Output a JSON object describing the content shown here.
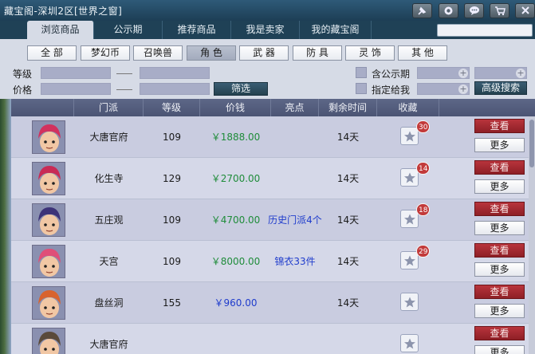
{
  "window": {
    "title": "藏宝阁-深圳2区[世界之窗]"
  },
  "tabs": [
    {
      "label": "浏览商品",
      "active": true
    },
    {
      "label": "公示期",
      "active": false
    },
    {
      "label": "推荐商品",
      "active": false
    },
    {
      "label": "我是卖家",
      "active": false
    },
    {
      "label": "我的藏宝阁",
      "active": false
    }
  ],
  "search": {
    "value": "",
    "placeholder": ""
  },
  "categories": [
    {
      "label": "全 部",
      "active": false
    },
    {
      "label": "梦幻币",
      "active": false
    },
    {
      "label": "召唤兽",
      "active": false
    },
    {
      "label": "角 色",
      "active": true
    },
    {
      "label": "武 器",
      "active": false
    },
    {
      "label": "防 具",
      "active": false
    },
    {
      "label": "灵 饰",
      "active": false
    },
    {
      "label": "其 他",
      "active": false
    }
  ],
  "filter": {
    "level_label": "等级",
    "price_label": "价格",
    "filter_button": "筛选",
    "include_public_label": "含公示期",
    "designated_label": "指定给我",
    "advanced_search_button": "高级搜索"
  },
  "table": {
    "headers": [
      "门派",
      "等级",
      "价钱",
      "亮点",
      "剩余时间",
      "收藏"
    ],
    "view_label": "查看",
    "more_label": "更多",
    "rows": [
      {
        "school": "大唐官府",
        "level": "109",
        "price": "￥1888.00",
        "price_color": "green",
        "highlight": "",
        "time": "14天",
        "favorites": "30",
        "avatar_color": "#b8365a",
        "hair_color": "#d2315e"
      },
      {
        "school": "化生寺",
        "level": "129",
        "price": "￥2700.00",
        "price_color": "green",
        "highlight": "",
        "time": "14天",
        "favorites": "14",
        "avatar_color": "#b8365a",
        "hair_color": "#c92b55"
      },
      {
        "school": "五庄观",
        "level": "109",
        "price": "￥4700.00",
        "price_color": "green",
        "highlight": "历史门派4个",
        "time": "14天",
        "favorites": "18",
        "avatar_color": "#4a3f8c",
        "hair_color": "#3d3278"
      },
      {
        "school": "天宫",
        "level": "109",
        "price": "￥8000.00",
        "price_color": "green",
        "highlight": "锦衣33件",
        "time": "14天",
        "favorites": "29",
        "avatar_color": "#d2426a",
        "hair_color": "#e04f78"
      },
      {
        "school": "盘丝洞",
        "level": "155",
        "price": "￥960.00",
        "price_color": "blue",
        "highlight": "",
        "time": "14天",
        "favorites": "",
        "avatar_color": "#cc5b2c",
        "hair_color": "#d8632e"
      },
      {
        "school": "大唐官府",
        "level": "",
        "price": "",
        "price_color": "green",
        "highlight": "",
        "time": "",
        "favorites": "",
        "avatar_color": "#6a5a4a",
        "hair_color": "#5a4a3a"
      }
    ]
  },
  "icons": {
    "toolbar": [
      "pin-icon",
      "settings-icon",
      "chat-icon",
      "cart-icon",
      "close-icon"
    ]
  }
}
